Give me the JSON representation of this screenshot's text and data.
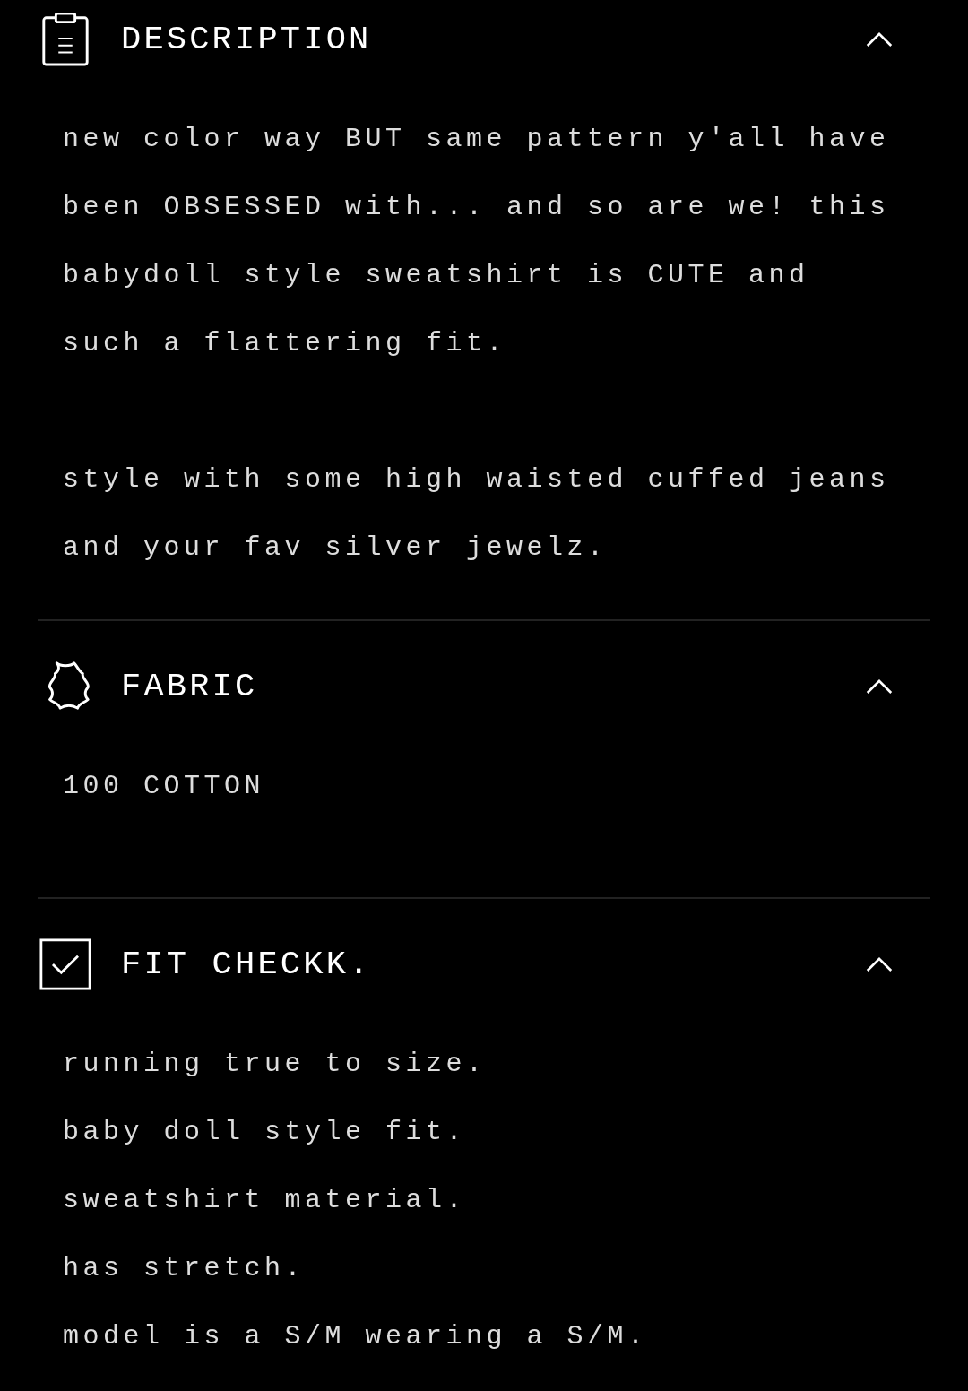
{
  "sections": [
    {
      "title": "DESCRIPTION",
      "expanded": true,
      "kind": "paragraphs",
      "body": [
        "new color way BUT same pattern y'all have been OBSESSED with... and so are we! this babydoll style sweatshirt is CUTE and such a flattering fit.",
        "style with some high waisted cuffed jeans and your fav silver jewelz."
      ]
    },
    {
      "title": "FABRIC",
      "expanded": true,
      "kind": "lines",
      "body": [
        "100 COTTON"
      ]
    },
    {
      "title": "FIT CHECKK.",
      "expanded": true,
      "kind": "lines",
      "body": [
        "running true to size.",
        "baby doll style fit.",
        "sweatshirt material.",
        "has stretch.",
        "model is a S/M wearing a S/M."
      ]
    }
  ]
}
